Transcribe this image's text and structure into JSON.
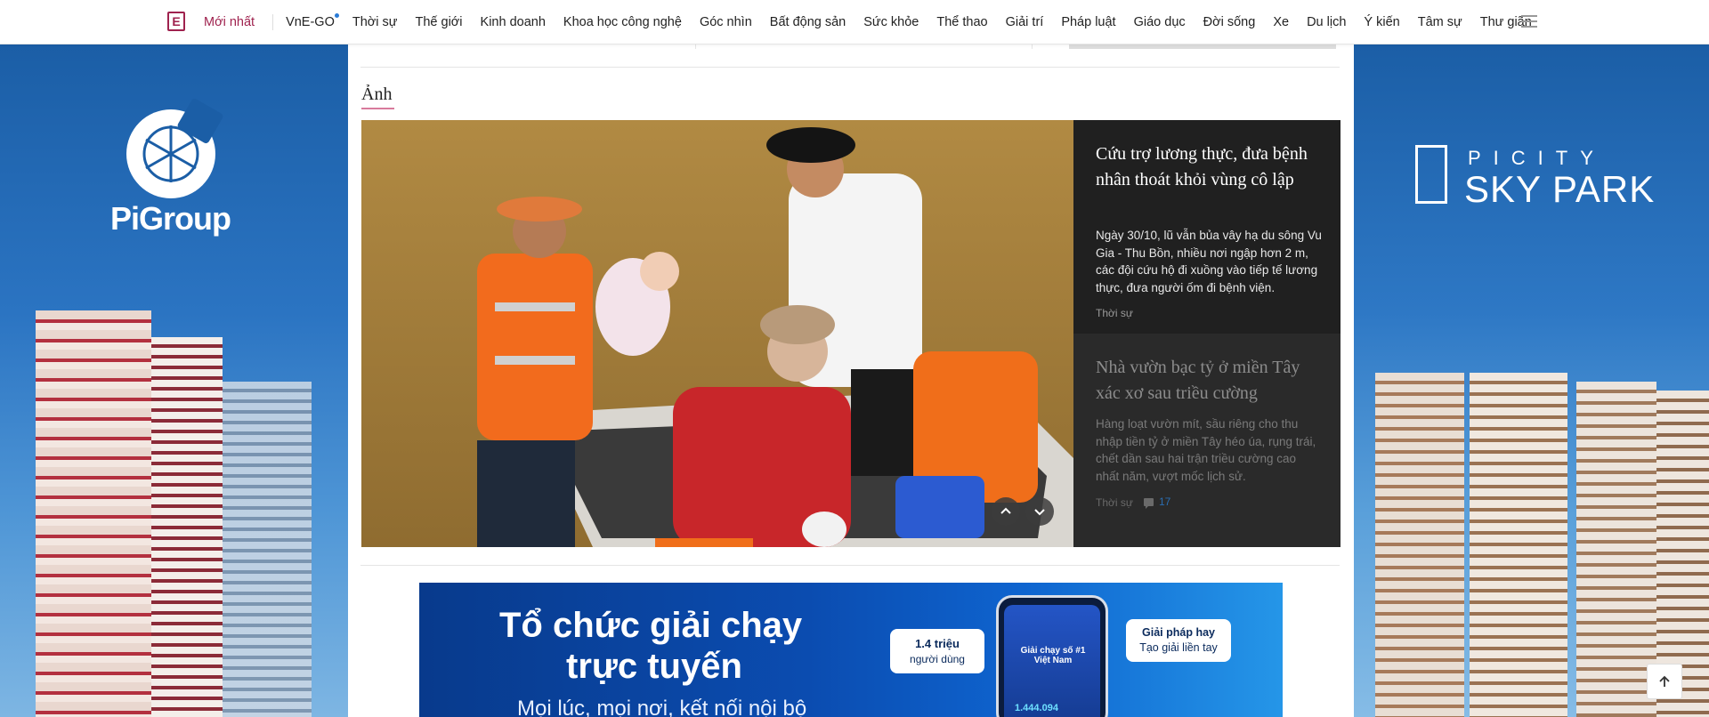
{
  "nav": {
    "logo_text": "E",
    "items": [
      {
        "label": "Mới nhất",
        "active": true
      },
      {
        "label": "VnE-GO",
        "badge_dot": true
      },
      {
        "label": "Thời sự"
      },
      {
        "label": "Thế giới"
      },
      {
        "label": "Kinh doanh"
      },
      {
        "label": "Khoa học công nghệ"
      },
      {
        "label": "Góc nhìn"
      },
      {
        "label": "Bất động sản"
      },
      {
        "label": "Sức khỏe"
      },
      {
        "label": "Thể thao"
      },
      {
        "label": "Giải trí"
      },
      {
        "label": "Pháp luật"
      },
      {
        "label": "Giáo dục"
      },
      {
        "label": "Đời sống"
      },
      {
        "label": "Xe"
      },
      {
        "label": "Du lịch"
      },
      {
        "label": "Ý kiến"
      },
      {
        "label": "Tâm sự"
      },
      {
        "label": "Thư giãn"
      }
    ],
    "menu_icon": "hamburger-icon"
  },
  "ads": {
    "left_brand": "PiGroup",
    "right_brand_top": "PICITY",
    "right_brand_main": "SKY PARK"
  },
  "section": {
    "title": "Ảnh",
    "stories": [
      {
        "title": "Cứu trợ lương thực, đưa bệnh nhân thoát khỏi vùng cô lập",
        "description": "Ngày 30/10, lũ vẫn bủa vây hạ du sông Vu Gia - Thu Bồn, nhiều nơi ngập hơn 2 m, các đội cứu hộ đi xuồng vào tiếp tế lương thực, đưa người ốm đi bệnh viện.",
        "category": "Thời sự"
      },
      {
        "title": "Nhà vườn bạc tỷ ở miền Tây xác xơ sau triều cường",
        "description": "Hàng loạt vườn mít, sầu riêng cho thu nhập tiền tỷ ở miền Tây héo úa, rụng trái, chết dần sau hai trận triều cường cao nhất năm, vượt mốc lịch sử.",
        "category": "Thời sự",
        "comments": "17"
      }
    ]
  },
  "banner": {
    "headline_line1": "Tổ chức giải chạy",
    "headline_line2": "trực tuyến",
    "subline": "Mọi lúc, mọi nơi, kết nối nội bộ",
    "chip1_big": "1.4 triệu",
    "chip1_small": "người dùng",
    "chip2_big": "Giải pháp hay",
    "chip2_small": "Tạo giải liền tay",
    "phone_text": "Giải chạy số #1 Việt Nam",
    "phone_number": "1.444.094"
  },
  "colors": {
    "brand": "#9f224e",
    "panel_bg": "#1e1e1e",
    "link_blue": "#2a6db0"
  }
}
